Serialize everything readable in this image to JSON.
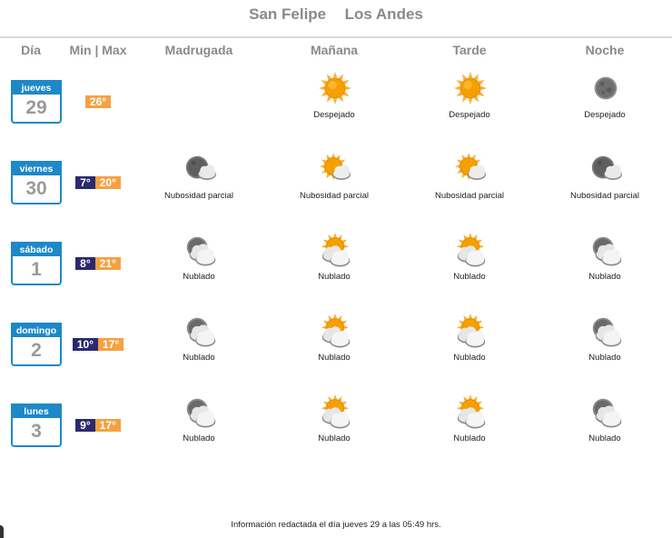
{
  "tabs": [
    "San Felipe",
    "Los Andes"
  ],
  "columns": {
    "dia": "Día",
    "minmax": "Min | Max",
    "madrugada": "Madrugada",
    "manana": "Mañana",
    "tarde": "Tarde",
    "noche": "Noche"
  },
  "days": [
    {
      "name": "jueves",
      "num": "29",
      "min": "",
      "max": "26°",
      "periods": [
        {
          "icon": "",
          "desc": ""
        },
        {
          "icon": "sun-icon",
          "desc": "Despejado"
        },
        {
          "icon": "sun-icon",
          "desc": "Despejado"
        },
        {
          "icon": "moon-icon",
          "desc": "Despejado"
        }
      ]
    },
    {
      "name": "viernes",
      "num": "30",
      "min": "7°",
      "max": "20°",
      "periods": [
        {
          "icon": "moon-cloud-icon",
          "desc": "Nubosidad parcial"
        },
        {
          "icon": "sun-cloud-icon",
          "desc": "Nubosidad parcial"
        },
        {
          "icon": "sun-cloud-icon",
          "desc": "Nubosidad parcial"
        },
        {
          "icon": "moon-cloud-icon",
          "desc": "Nubosidad parcial"
        }
      ]
    },
    {
      "name": "sábado",
      "num": "1",
      "min": "8°",
      "max": "21°",
      "periods": [
        {
          "icon": "moon-clouds-icon",
          "desc": "Nublado"
        },
        {
          "icon": "sun-clouds-icon",
          "desc": "Nublado"
        },
        {
          "icon": "sun-clouds-icon",
          "desc": "Nublado"
        },
        {
          "icon": "moon-clouds-icon",
          "desc": "Nublado"
        }
      ]
    },
    {
      "name": "domingo",
      "num": "2",
      "min": "10°",
      "max": "17°",
      "periods": [
        {
          "icon": "moon-clouds-icon",
          "desc": "Nublado"
        },
        {
          "icon": "sun-clouds-icon",
          "desc": "Nublado"
        },
        {
          "icon": "sun-clouds-icon",
          "desc": "Nublado"
        },
        {
          "icon": "moon-clouds-icon",
          "desc": "Nublado"
        }
      ]
    },
    {
      "name": "lunes",
      "num": "3",
      "min": "9°",
      "max": "17°",
      "periods": [
        {
          "icon": "moon-clouds-icon",
          "desc": "Nublado"
        },
        {
          "icon": "sun-clouds-icon",
          "desc": "Nublado"
        },
        {
          "icon": "sun-clouds-icon",
          "desc": "Nublado"
        },
        {
          "icon": "moon-clouds-icon",
          "desc": "Nublado"
        }
      ]
    }
  ],
  "footer": "Información redactada el día jueves 29 a las 05:49 hrs.",
  "colors": {
    "accent": "#1e88c8",
    "min_bg": "#2a2a6e",
    "max_bg": "#f5a142",
    "sun": "#f5a000",
    "header_text": "#8a8a8a"
  }
}
